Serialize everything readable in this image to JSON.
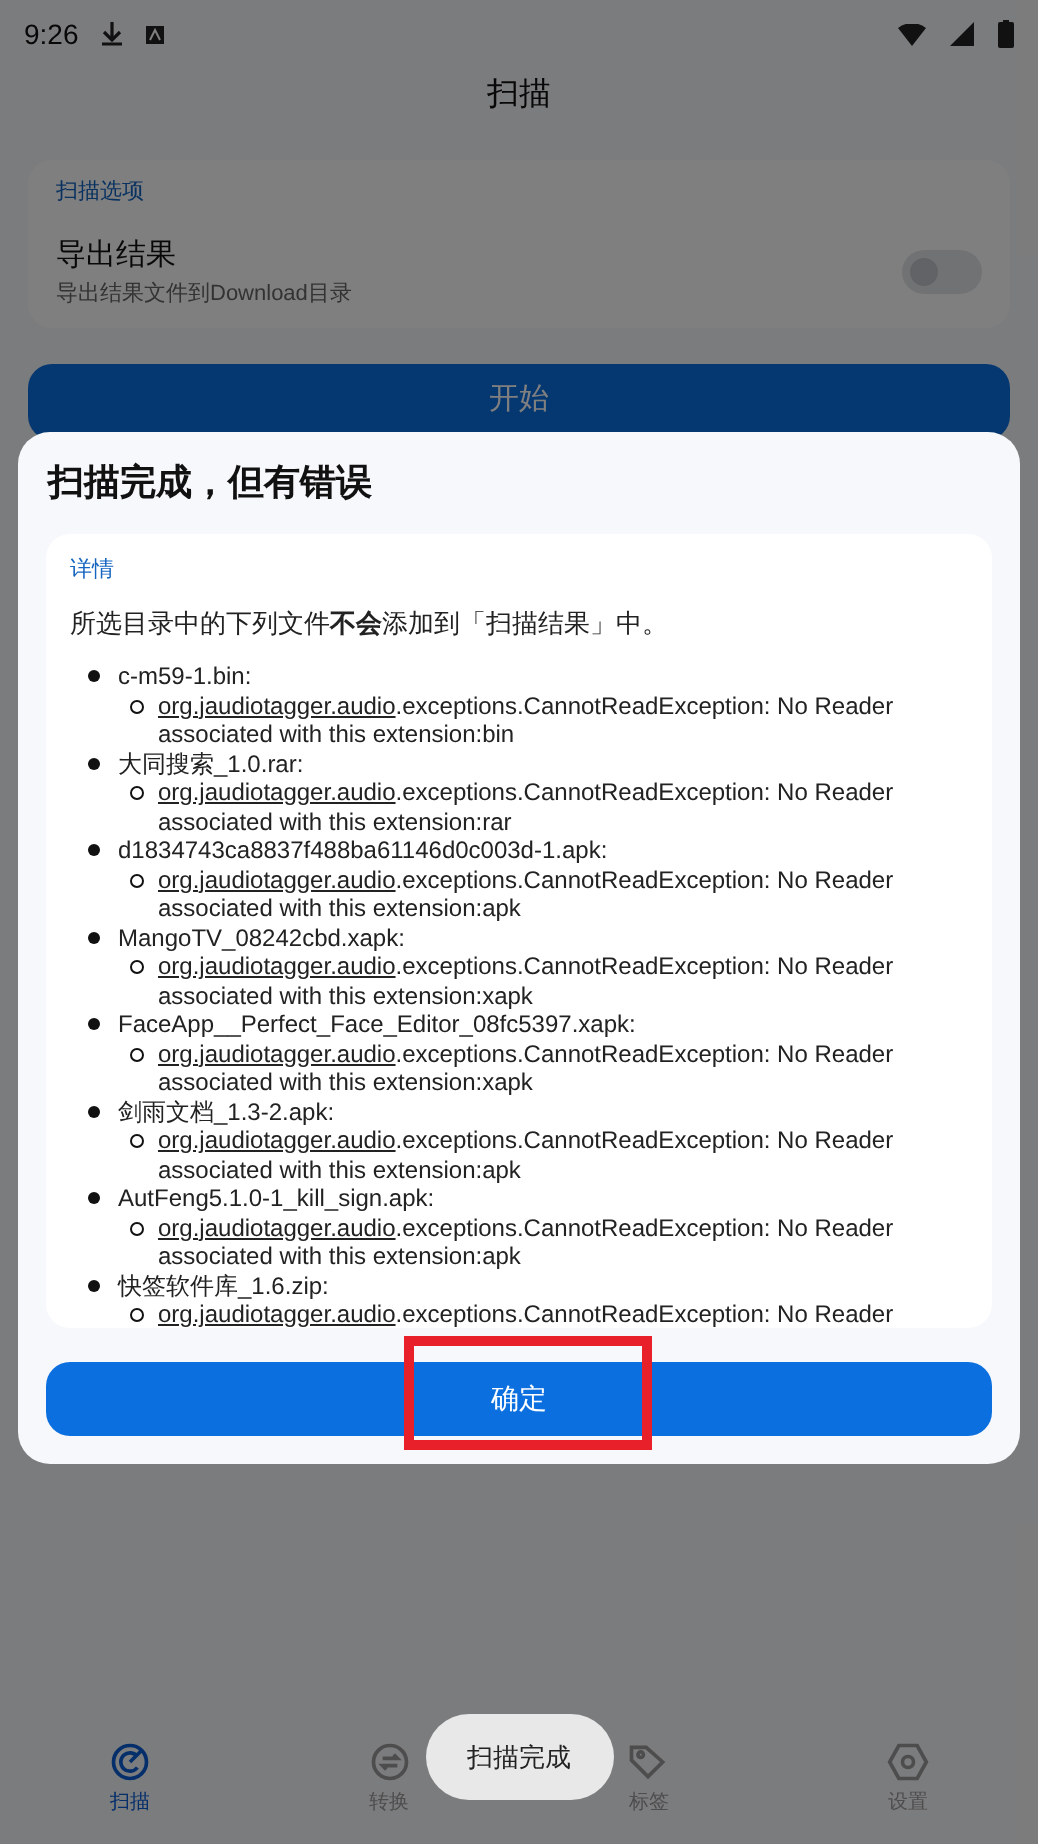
{
  "status_bar": {
    "time": "9:26"
  },
  "page": {
    "title": "扫描",
    "options_card": {
      "heading": "扫描选项",
      "setting": {
        "label": "导出结果",
        "description": "导出结果文件到Download目录",
        "on": false
      }
    },
    "start_button": "开始"
  },
  "dialog": {
    "title": "扫描完成，但有错误",
    "details_label": "详情",
    "intro": "所选目录中的下列文件**不会**添加到「扫描结果」中。",
    "files": [
      {
        "name": "c-m59-1.bin:",
        "link": "org.jaudiotagger.audio",
        "message": ".exceptions.CannotReadException: No Reader associated with this extension:bin"
      },
      {
        "name": "大同搜索_1.0.rar:",
        "link": "org.jaudiotagger.audio",
        "message": ".exceptions.CannotReadException: No Reader associated with this extension:rar"
      },
      {
        "name": "d1834743ca8837f488ba61146d0c003d-1.apk:",
        "link": "org.jaudiotagger.audio",
        "message": ".exceptions.CannotReadException: No Reader associated with this extension:apk"
      },
      {
        "name": "MangoTV_08242cbd.xapk:",
        "link": "org.jaudiotagger.audio",
        "message": ".exceptions.CannotReadException: No Reader associated with this extension:xapk"
      },
      {
        "name": "FaceApp__Perfect_Face_Editor_08fc5397.xapk:",
        "link": "org.jaudiotagger.audio",
        "message": ".exceptions.CannotReadException: No Reader associated with this extension:xapk"
      },
      {
        "name": "剑雨文档_1.3-2.apk:",
        "link": "org.jaudiotagger.audio",
        "message": ".exceptions.CannotReadException: No Reader associated with this extension:apk"
      },
      {
        "name": "AutFeng5.1.0-1_kill_sign.apk:",
        "link": "org.jaudiotagger.audio",
        "message": ".exceptions.CannotReadException: No Reader associated with this extension:apk"
      },
      {
        "name": "快签软件库_1.6.zip:",
        "link": "org.jaudiotagger.audio",
        "message": ".exceptions.CannotReadException: No Reader"
      }
    ],
    "confirm_button": "确定"
  },
  "toast": "扫描完成",
  "bottom_nav": [
    {
      "label": "扫描",
      "selected": true
    },
    {
      "label": "转换",
      "selected": false
    },
    {
      "label": "标签",
      "selected": false
    },
    {
      "label": "设置",
      "selected": false
    }
  ]
}
